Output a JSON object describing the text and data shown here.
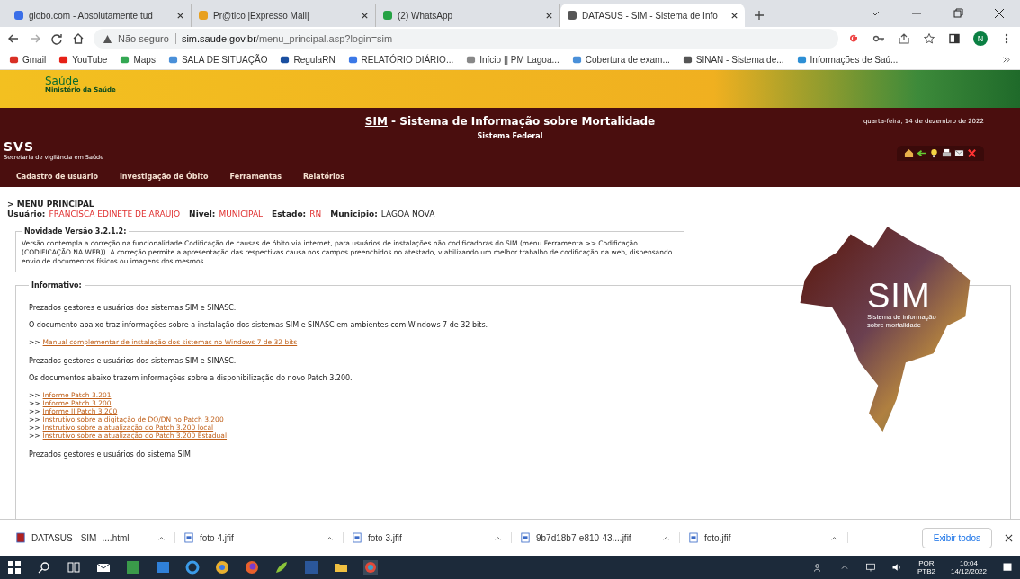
{
  "browser": {
    "tabs": [
      {
        "title": "globo.com - Absolutamente tud",
        "selected": false
      },
      {
        "title": "Pr@tico |Expresso Mail|",
        "selected": false
      },
      {
        "title": "(2) WhatsApp",
        "selected": false
      },
      {
        "title": "DATASUS - SIM - Sistema de Info",
        "selected": true
      }
    ],
    "address": {
      "security": "Não seguro",
      "host": "sim.saude.gov.br",
      "path": "/menu_principal.asp?login=sim"
    },
    "profile_initial": "N",
    "bookmarks": [
      "Gmail",
      "YouTube",
      "Maps",
      "SALA DE SITUAÇÃO",
      "RegulaRN",
      "RELATÓRIO DIÁRIO...",
      "Início || PM Lagoa...",
      "Cobertura de exam...",
      "SINAN - Sistema de...",
      "Informações de Saú..."
    ]
  },
  "page": {
    "banner": {
      "title": "Saúde",
      "subtitle": "Ministério da Saúde"
    },
    "header": {
      "title_abbr": "SIM",
      "title_rest": " - Sistema de Informação sobre Mortalidade",
      "subtitle": "Sistema Federal",
      "date": "quarta-feira, 14 de dezembro de 2022",
      "logo": "SVS",
      "logo_caption": "Secretaria de vigilância em Saúde"
    },
    "menu": [
      "Cadastro de usuário",
      "Investigação de Óbito",
      "Ferramentas",
      "Relatórios"
    ],
    "breadcrumb": "> MENU PRINCIPAL",
    "user_info": [
      {
        "label": "Usuário:",
        "value": "FRANCISCA EDINETE DE ARAUJO",
        "highlight": true
      },
      {
        "label": "Nivel:",
        "value": "MUNICIPAL",
        "highlight": true
      },
      {
        "label": "Estado:",
        "value": "RN",
        "highlight": true
      },
      {
        "label": "Municipio:",
        "value": "LAGOA NOVA",
        "highlight": false
      }
    ],
    "novidade": {
      "legend": "Novidade Versão 3.2.1.2:",
      "text": "Versão contempla a correção na funcionalidade Codificação de causas de óbito via internet, para usuários de instalações não codificadoras do SIM (menu Ferramenta >> Codificação (CODIFICAÇÃO NA WEB)). A correção permite a apresentação das respectivas causa nos campos preenchidos no atestado, viabilizando um melhor trabalho de codificação na web, dispensando envio de documentos físicos ou imagens dos mesmos."
    },
    "informativo": {
      "legend": "Informativo:",
      "blocks": [
        {
          "kind": "paragraph",
          "text": "Prezados gestores e usuários dos sistemas SIM e SINASC."
        },
        {
          "kind": "paragraph",
          "text": "O documento abaixo traz informações sobre a instalação dos sistemas SIM e SINASC em ambientes com Windows 7 de 32 bits."
        },
        {
          "kind": "links",
          "items": [
            "Manual complementar de instalação dos sistemas no Windows 7 de 32 bits"
          ]
        },
        {
          "kind": "paragraph",
          "text": "Prezados gestores e usuários dos sistemas SIM e SINASC."
        },
        {
          "kind": "paragraph",
          "text": "Os documentos abaixo trazem informações sobre a disponibilização do novo Patch 3.200."
        },
        {
          "kind": "links",
          "items": [
            "Informe Patch 3.201",
            "Informe Patch 3.200",
            "Informe II Patch 3.200",
            "Instrutivo sobre a digitação de DO/DN no Patch 3.200",
            "Instrutivo sobre a atualização do Patch 3.200 local",
            "Instrutivo sobre a atualização do Patch 3.200 Estadual"
          ]
        },
        {
          "kind": "paragraph",
          "text": "Prezados gestores e usuários do sistema SIM"
        }
      ],
      "link_prefix": ">>"
    },
    "logo": {
      "title": "SIM",
      "caption": "Sistema de informação sobre mortalidade"
    }
  },
  "downloads": {
    "items": [
      {
        "name": "DATASUS - SIM -....html",
        "kind": "html"
      },
      {
        "name": "foto 4.jfif",
        "kind": "image"
      },
      {
        "name": "foto 3.jfif",
        "kind": "image"
      },
      {
        "name": "9b7d18b7-e810-43....jfif",
        "kind": "image"
      },
      {
        "name": "foto.jfif",
        "kind": "image"
      }
    ],
    "show_all": "Exibir todos"
  },
  "taskbar": {
    "language": "POR",
    "layout": "PTB2",
    "time": "10:04",
    "date": "14/12/2022"
  }
}
